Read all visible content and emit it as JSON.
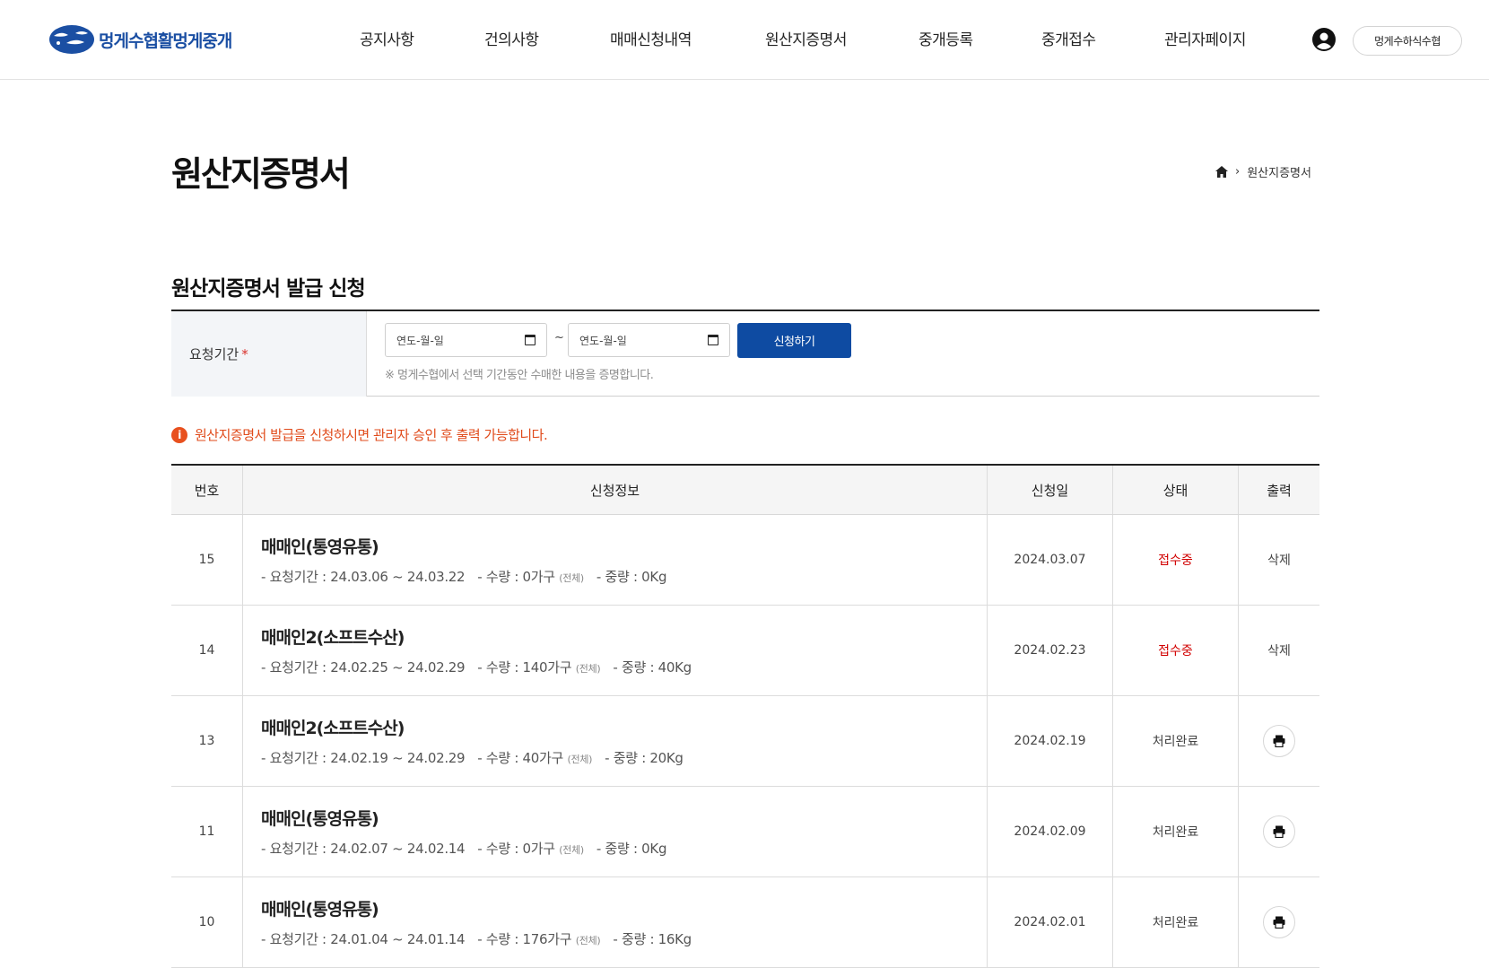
{
  "header": {
    "logo_text": "멍게수협활멍게중개",
    "nav": [
      "공지사항",
      "건의사항",
      "매매신청내역",
      "원산지증명서",
      "중개등록",
      "중개접수",
      "관리자페이지"
    ],
    "user_label": "멍게수하식수협"
  },
  "page": {
    "title": "원산지증명서",
    "breadcrumb_current": "원산지증명서"
  },
  "form": {
    "section_title": "원산지증명서 발급 신청",
    "label": "요청기간",
    "required_mark": "*",
    "date_from_placeholder": "연도-월-일",
    "date_to_placeholder": "연도-월-일",
    "tilde": "~",
    "submit_label": "신청하기",
    "note": "※ 멍게수협에서 선택 기간동안 수매한 내용을 증명합니다."
  },
  "notice": {
    "icon_char": "i",
    "text": "원산지증명서 발급을 신청하시면 관리자 승인 후 출력 가능합니다."
  },
  "table": {
    "headers": [
      "번호",
      "신청정보",
      "신청일",
      "상태",
      "출력"
    ],
    "rows": [
      {
        "no": "15",
        "name": "매매인(통영유통)",
        "period": "- 요청기간 : 24.03.06 ~ 24.03.22",
        "qty": "- 수량 : 0가구",
        "qty_sub": "(전체)",
        "weight": "- 중량 : 0Kg",
        "date": "2024.03.07",
        "status": "접수중",
        "action": "삭제"
      },
      {
        "no": "14",
        "name": "매매인2(소프트수산)",
        "period": "- 요청기간 : 24.02.25 ~ 24.02.29",
        "qty": "- 수량 : 140가구",
        "qty_sub": "(전체)",
        "weight": "- 중량 : 40Kg",
        "date": "2024.02.23",
        "status": "접수중",
        "action": "삭제"
      },
      {
        "no": "13",
        "name": "매매인2(소프트수산)",
        "period": "- 요청기간 : 24.02.19 ~ 24.02.29",
        "qty": "- 수량 : 40가구",
        "qty_sub": "(전체)",
        "weight": "- 중량 : 20Kg",
        "date": "2024.02.19",
        "status": "처리완료",
        "action": "print"
      },
      {
        "no": "11",
        "name": "매매인(통영유통)",
        "period": "- 요청기간 : 24.02.07 ~ 24.02.14",
        "qty": "- 수량 : 0가구",
        "qty_sub": "(전체)",
        "weight": "- 중량 : 0Kg",
        "date": "2024.02.09",
        "status": "처리완료",
        "action": "print"
      },
      {
        "no": "10",
        "name": "매매인(통영유통)",
        "period": "- 요청기간 : 24.01.04 ~ 24.01.14",
        "qty": "- 수량 : 176가구",
        "qty_sub": "(전체)",
        "weight": "- 중량 : 16Kg",
        "date": "2024.02.01",
        "status": "처리완료",
        "action": "print"
      }
    ]
  },
  "colors": {
    "brand": "#0e4ba2",
    "status_pending": "#d10000",
    "notice": "#e04a1a"
  }
}
